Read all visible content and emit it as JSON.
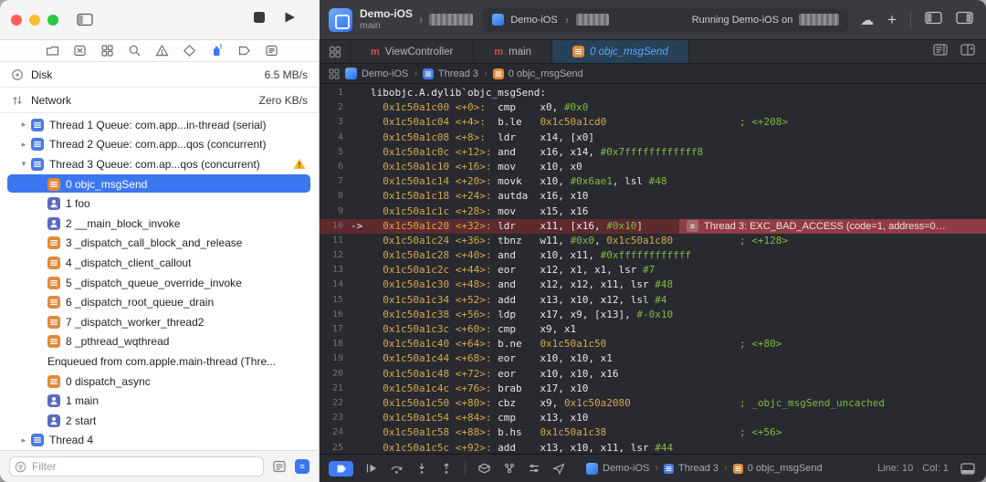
{
  "toolbar": {
    "scheme_name": "Demo-iOS",
    "scheme_branch": "main",
    "pill_project": "Demo-iOS",
    "pill_status": "Running Demo-iOS on",
    "plus_label": "+",
    "cloud_icon": "cloud-icon"
  },
  "navbar": {
    "icons": [
      "project-navigator",
      "source-control-navigator",
      "symbol-navigator",
      "find-navigator",
      "issue-navigator",
      "test-navigator",
      "debug-navigator",
      "breakpoint-navigator",
      "report-navigator"
    ],
    "active": "debug-navigator"
  },
  "sidebar": {
    "gauges": [
      {
        "label": "Disk",
        "value": "6.5 MB/s"
      },
      {
        "label": "Network",
        "value": "Zero KB/s"
      }
    ],
    "filter_placeholder": "Filter",
    "rows": [
      {
        "type": "thread",
        "expanded": false,
        "label": "Thread 1 Queue: com.app...in-thread (serial)"
      },
      {
        "type": "thread",
        "expanded": false,
        "label": "Thread 2 Queue: com.app...qos (concurrent)"
      },
      {
        "type": "thread",
        "expanded": true,
        "warning": true,
        "label": "Thread 3 Queue: com.ap...qos (concurrent)"
      },
      {
        "type": "frame",
        "icon": "orange",
        "selected": true,
        "label": "0 objc_msgSend"
      },
      {
        "type": "frame",
        "icon": "blue",
        "label": "1 foo"
      },
      {
        "type": "frame",
        "icon": "blue",
        "label": "2 __main_block_invoke"
      },
      {
        "type": "frame",
        "icon": "orange",
        "label": "3 _dispatch_call_block_and_release"
      },
      {
        "type": "frame",
        "icon": "orange",
        "label": "4 _dispatch_client_callout"
      },
      {
        "type": "frame",
        "icon": "orange",
        "label": "5 _dispatch_queue_override_invoke"
      },
      {
        "type": "frame",
        "icon": "orange",
        "label": "6 _dispatch_root_queue_drain"
      },
      {
        "type": "frame",
        "icon": "orange",
        "label": "7 _dispatch_worker_thread2"
      },
      {
        "type": "frame",
        "icon": "orange",
        "label": "8 _pthread_wqthread"
      },
      {
        "type": "section",
        "label": "Enqueued from com.apple.main-thread (Thre..."
      },
      {
        "type": "frame",
        "icon": "orange",
        "label": "0 dispatch_async"
      },
      {
        "type": "frame",
        "icon": "blue",
        "label": "1 main"
      },
      {
        "type": "frame",
        "icon": "blue",
        "label": "2 start"
      },
      {
        "type": "thread",
        "expanded": false,
        "label": "Thread 4"
      }
    ]
  },
  "tabbar": {
    "tabs": [
      {
        "label": "ViewController",
        "icon": "m",
        "active": false
      },
      {
        "label": "main",
        "icon": "m",
        "active": false
      },
      {
        "label": "0 objc_msgSend",
        "icon": "orange",
        "active": true
      }
    ]
  },
  "jumpbar": {
    "crumbs": [
      {
        "icon": "app",
        "label": "Demo-iOS"
      },
      {
        "icon": "thread",
        "label": "Thread 3"
      },
      {
        "icon": "orange",
        "label": "0 objc_msgSend"
      }
    ]
  },
  "editor": {
    "crash": {
      "line": 10,
      "text": "Thread 3: EXC_BAD_ACCESS (code=1, address=0…"
    },
    "lines": [
      {
        "n": 1,
        "s": [
          [
            "p",
            "libobjc.A.dylib`objc_msgSend:"
          ]
        ]
      },
      {
        "n": 2,
        "s": [
          [
            "a",
            "  0x1c50a1c00 <+0>:  "
          ],
          [
            "p",
            "cmp    x0, "
          ],
          [
            "g",
            "#0x0"
          ]
        ]
      },
      {
        "n": 3,
        "s": [
          [
            "a",
            "  0x1c50a1c04 <+4>:  "
          ],
          [
            "p",
            "b.le   "
          ],
          [
            "a",
            "0x1c50a1cd0"
          ],
          [
            "p",
            "                      "
          ],
          [
            "g",
            "; <+208>"
          ]
        ]
      },
      {
        "n": 4,
        "s": [
          [
            "a",
            "  0x1c50a1c08 <+8>:  "
          ],
          [
            "p",
            "ldr    x14, [x0]"
          ]
        ]
      },
      {
        "n": 5,
        "s": [
          [
            "a",
            "  0x1c50a1c0c <+12>: "
          ],
          [
            "p",
            "and    x16, x14, "
          ],
          [
            "g",
            "#0x7ffffffffffff8"
          ]
        ]
      },
      {
        "n": 6,
        "s": [
          [
            "a",
            "  0x1c50a1c10 <+16>: "
          ],
          [
            "p",
            "mov    x10, x0"
          ]
        ]
      },
      {
        "n": 7,
        "s": [
          [
            "a",
            "  0x1c50a1c14 <+20>: "
          ],
          [
            "p",
            "movk   x10, "
          ],
          [
            "g",
            "#0x6ae1"
          ],
          [
            "p",
            ", lsl "
          ],
          [
            "g",
            "#48"
          ]
        ]
      },
      {
        "n": 8,
        "s": [
          [
            "a",
            "  0x1c50a1c18 <+24>: "
          ],
          [
            "p",
            "autda  x16, x10"
          ]
        ]
      },
      {
        "n": 9,
        "s": [
          [
            "a",
            "  0x1c50a1c1c <+28>: "
          ],
          [
            "p",
            "mov    x15, x16"
          ]
        ]
      },
      {
        "n": 10,
        "crash": true,
        "s": [
          [
            "a",
            "  0x1c50a1c20 <+32>: "
          ],
          [
            "p",
            "ldr    x11, [x16, "
          ],
          [
            "g",
            "#0x10"
          ],
          [
            "p",
            "]"
          ]
        ]
      },
      {
        "n": 11,
        "s": [
          [
            "a",
            "  0x1c50a1c24 <+36>: "
          ],
          [
            "p",
            "tbnz   w11, "
          ],
          [
            "g",
            "#0x0"
          ],
          [
            "p",
            ", "
          ],
          [
            "a",
            "0x1c50a1c80"
          ],
          [
            "p",
            "           "
          ],
          [
            "g",
            "; <+128>"
          ]
        ]
      },
      {
        "n": 12,
        "s": [
          [
            "a",
            "  0x1c50a1c28 <+40>: "
          ],
          [
            "p",
            "and    x10, x11, "
          ],
          [
            "g",
            "#0xffffffffffff"
          ]
        ]
      },
      {
        "n": 13,
        "s": [
          [
            "a",
            "  0x1c50a1c2c <+44>: "
          ],
          [
            "p",
            "eor    x12, x1, x1, lsr "
          ],
          [
            "g",
            "#7"
          ]
        ]
      },
      {
        "n": 14,
        "s": [
          [
            "a",
            "  0x1c50a1c30 <+48>: "
          ],
          [
            "p",
            "and    x12, x12, x11, lsr "
          ],
          [
            "g",
            "#48"
          ]
        ]
      },
      {
        "n": 15,
        "s": [
          [
            "a",
            "  0x1c50a1c34 <+52>: "
          ],
          [
            "p",
            "add    x13, x10, x12, lsl "
          ],
          [
            "g",
            "#4"
          ]
        ]
      },
      {
        "n": 16,
        "s": [
          [
            "a",
            "  0x1c50a1c38 <+56>: "
          ],
          [
            "p",
            "ldp    x17, x9, [x13], "
          ],
          [
            "g",
            "#-0x10"
          ]
        ]
      },
      {
        "n": 17,
        "s": [
          [
            "a",
            "  0x1c50a1c3c <+60>: "
          ],
          [
            "p",
            "cmp    x9, x1"
          ]
        ]
      },
      {
        "n": 18,
        "s": [
          [
            "a",
            "  0x1c50a1c40 <+64>: "
          ],
          [
            "p",
            "b.ne   "
          ],
          [
            "a",
            "0x1c50a1c50"
          ],
          [
            "p",
            "                      "
          ],
          [
            "g",
            "; <+80>"
          ]
        ]
      },
      {
        "n": 19,
        "s": [
          [
            "a",
            "  0x1c50a1c44 <+68>: "
          ],
          [
            "p",
            "eor    x10, x10, x1"
          ]
        ]
      },
      {
        "n": 20,
        "s": [
          [
            "a",
            "  0x1c50a1c48 <+72>: "
          ],
          [
            "p",
            "eor    x10, x10, x16"
          ]
        ]
      },
      {
        "n": 21,
        "s": [
          [
            "a",
            "  0x1c50a1c4c <+76>: "
          ],
          [
            "p",
            "brab   x17, x10"
          ]
        ]
      },
      {
        "n": 22,
        "s": [
          [
            "a",
            "  0x1c50a1c50 <+80>: "
          ],
          [
            "p",
            "cbz    x9, "
          ],
          [
            "a",
            "0x1c50a2080"
          ],
          [
            "p",
            "                  "
          ],
          [
            "g",
            "; _objc_msgSend_uncached"
          ]
        ]
      },
      {
        "n": 23,
        "s": [
          [
            "a",
            "  0x1c50a1c54 <+84>: "
          ],
          [
            "p",
            "cmp    x13, x10"
          ]
        ]
      },
      {
        "n": 24,
        "s": [
          [
            "a",
            "  0x1c50a1c58 <+88>: "
          ],
          [
            "p",
            "b.hs   "
          ],
          [
            "a",
            "0x1c50a1c38"
          ],
          [
            "p",
            "                      "
          ],
          [
            "g",
            "; <+56>"
          ]
        ]
      },
      {
        "n": 25,
        "s": [
          [
            "a",
            "  0x1c50a1c5c <+92>: "
          ],
          [
            "p",
            "add    x13, x10, x11, lsr "
          ],
          [
            "g",
            "#44"
          ]
        ]
      }
    ]
  },
  "debugbar": {
    "crumbs": [
      {
        "icon": "app",
        "label": "Demo-iOS"
      },
      {
        "icon": "thread",
        "label": "Thread 3"
      },
      {
        "icon": "orange",
        "label": "0 objc_msgSend"
      }
    ],
    "line_label": "Line: 10",
    "col_label": "Col: 1"
  },
  "colors": {
    "accent_blue": "#3b76f0",
    "address_yellow": "#d2a94f",
    "immediate_green": "#82b742",
    "crash_row": "#5e2a2e",
    "crash_badge": "#8f3c42",
    "frame_orange": "#e08a3c",
    "frame_blue": "#5c6ac0",
    "active_tab_text": "#5ea8fa"
  }
}
